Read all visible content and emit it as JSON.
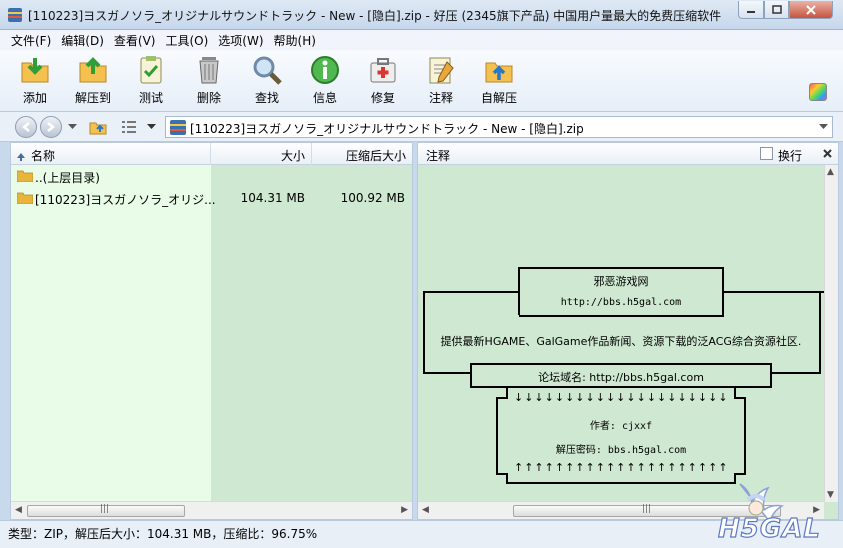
{
  "window": {
    "title": "[110223]ヨスガノソラ_オリジナルサウンドトラック - New - [隐白].zip - 好压 (2345旗下产品) 中国用户量最大的免费压缩软件"
  },
  "menu": [
    "文件(F)",
    "编辑(D)",
    "查看(V)",
    "工具(O)",
    "选项(W)",
    "帮助(H)"
  ],
  "toolbar": [
    {
      "label": "添加",
      "icon": "add-icon"
    },
    {
      "label": "解压到",
      "icon": "extract-icon"
    },
    {
      "label": "测试",
      "icon": "test-icon"
    },
    {
      "label": "删除",
      "icon": "delete-icon"
    },
    {
      "label": "查找",
      "icon": "search-icon"
    },
    {
      "label": "信息",
      "icon": "info-icon"
    },
    {
      "label": "修复",
      "icon": "repair-icon"
    },
    {
      "label": "注释",
      "icon": "comment-icon"
    },
    {
      "label": "自解压",
      "icon": "sfx-icon"
    }
  ],
  "address": {
    "path": "[110223]ヨスガノソラ_オリジナルサウンドトラック - New - [隐白].zip"
  },
  "list": {
    "columns": {
      "name": "名称",
      "size": "大小",
      "packed": "压缩后大小"
    },
    "rows": [
      {
        "name": "..(上层目录)",
        "size": "",
        "packed": ""
      },
      {
        "name": "[110223]ヨスガノソラ_オリジ...",
        "size": "104.31 MB",
        "packed": "100.92 MB"
      }
    ]
  },
  "comment": {
    "header": "注释",
    "wrap_label": "换行",
    "lines": {
      "site": "邪恶游戏网",
      "url1": "http://bbs.h5gal.com",
      "desc": "提供最新HGAME、GalGame作品新闻、资源下载的泛ACG综合资源社区.",
      "forum": "论坛域名: http://bbs.h5gal.com",
      "author": "作者: cjxxf",
      "password": "解压密码: bbs.h5gal.com",
      "down_arrows": "↓↓↓↓↓↓↓↓↓↓↓↓↓↓↓↓↓↓↓↓↓",
      "up_arrows": "↑↑↑↑↑↑↑↑↑↑↑↑↑↑↑↑↑↑↑↑↑"
    }
  },
  "status": {
    "text": "类型：ZIP，解压后大小：104.31 MB，压缩比：96.75%"
  },
  "watermark": {
    "text": "H5GAL"
  }
}
